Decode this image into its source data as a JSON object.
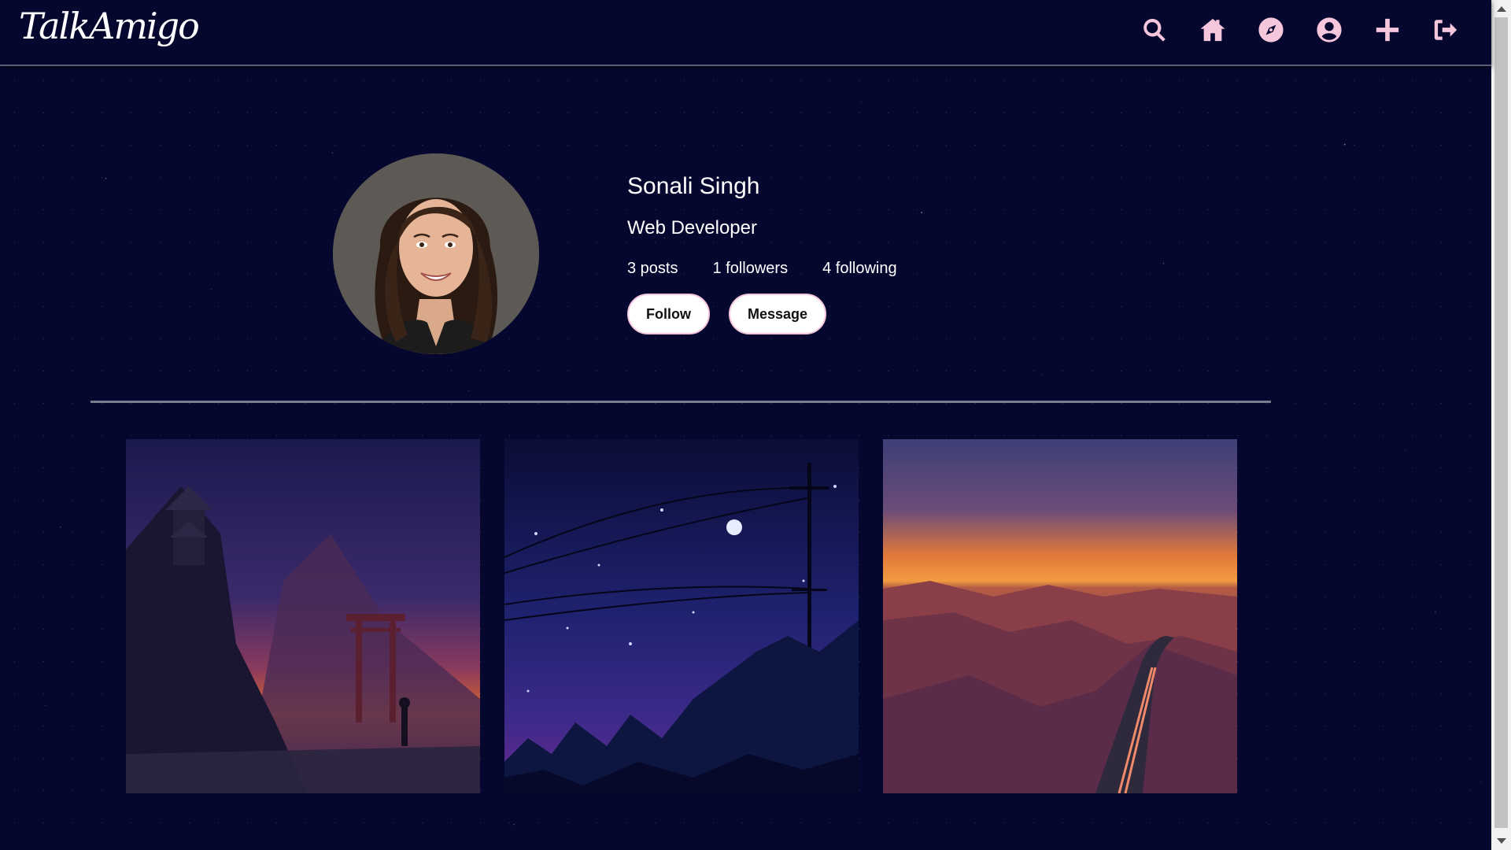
{
  "brand": {
    "logo_text": "TalkAmigo"
  },
  "nav": {
    "icons": [
      "search-icon",
      "home-icon",
      "compass-icon",
      "user-circle-icon",
      "plus-icon",
      "sign-out-icon"
    ],
    "icon_color": "#f5c6dc"
  },
  "profile": {
    "name": "Sonali Singh",
    "title": "Web Developer",
    "posts": "3 posts",
    "followers": "1 followers",
    "following": "4 following",
    "follow_label": "Follow",
    "message_label": "Message"
  },
  "posts": [
    {
      "scene": "pagoda-torii-sunset"
    },
    {
      "scene": "night-powerline-moon"
    },
    {
      "scene": "sunset-road"
    }
  ],
  "colors": {
    "background": "#06072f",
    "accent": "#f5c6dc"
  }
}
